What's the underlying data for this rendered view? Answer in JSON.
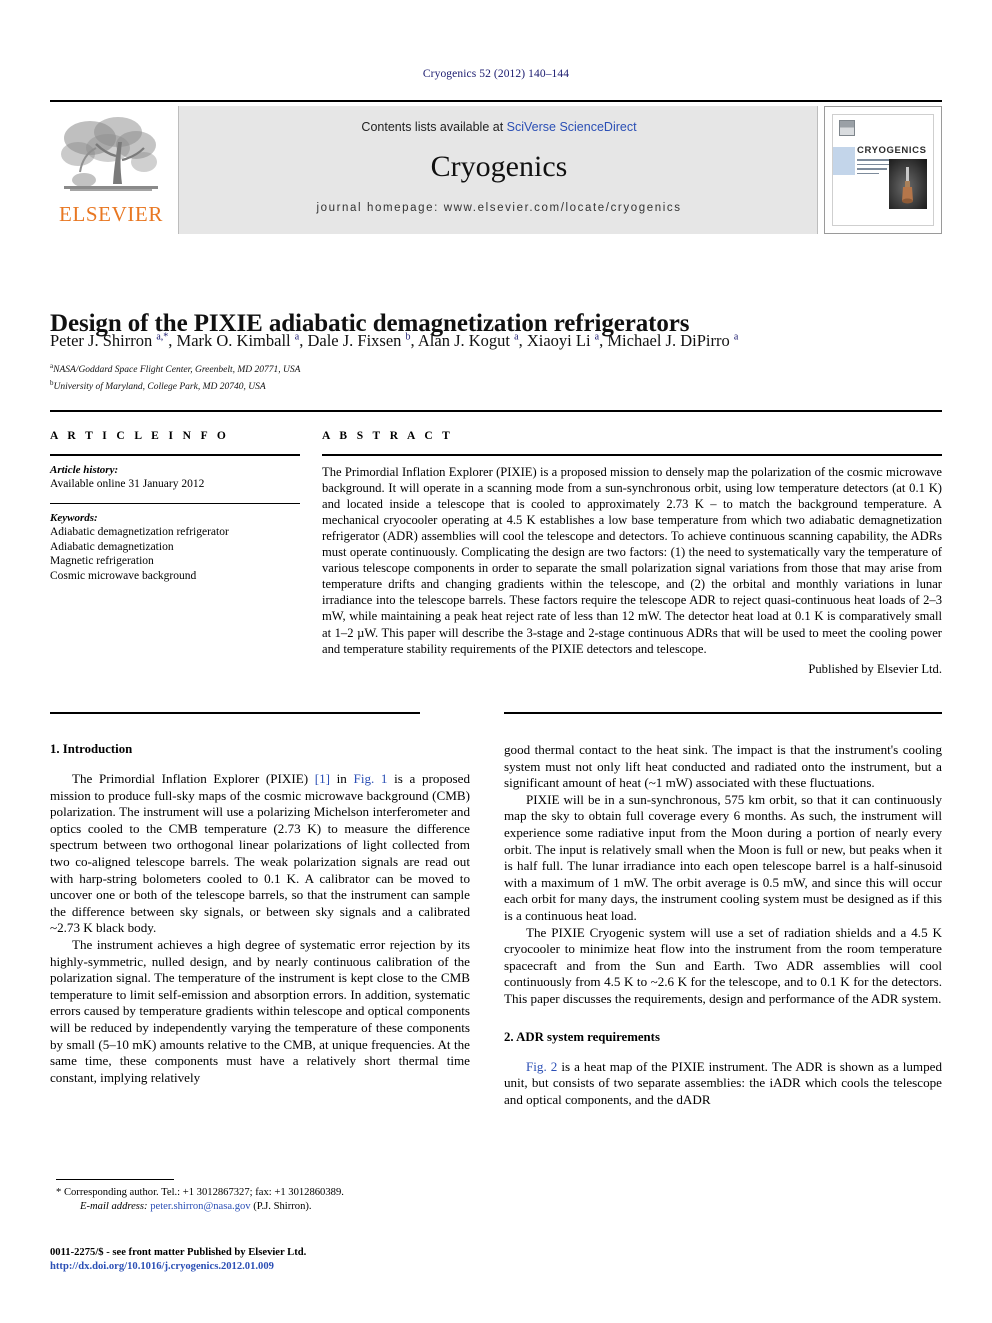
{
  "running_head": "Cryogenics 52 (2012) 140–144",
  "masthead": {
    "contents_prefix": "Contents lists available at ",
    "sciencedirect": "SciVerse ScienceDirect",
    "journal_title": "Cryogenics",
    "homepage": "journal homepage: www.elsevier.com/locate/cryogenics",
    "publisher_logo_text": "ELSEVIER",
    "cover_title": "CRYOGENICS"
  },
  "article": {
    "title": "Design of the PIXIE adiabatic demagnetization refrigerators",
    "authors_html": "Peter J. Shirron <sup>a,*</sup>, Mark O. Kimball <sup>a</sup>, Dale J. Fixsen <sup>b</sup>, Alan J. Kogut <sup>a</sup>, Xiaoyi Li <sup>a</sup>, Michael J. DiPirro <sup>a</sup>",
    "affiliation_a": "NASA/Goddard Space Flight Center, Greenbelt, MD 20771, USA",
    "affiliation_b": "University of Maryland, College Park, MD 20740, USA"
  },
  "article_info": {
    "heading": "A R T I C L E   I N F O",
    "history_label": "Article history:",
    "history_value": "Available online 31 January 2012",
    "keywords_label": "Keywords:",
    "keywords": [
      "Adiabatic demagnetization refrigerator",
      "Adiabatic demagnetization",
      "Magnetic refrigeration",
      "Cosmic microwave background"
    ]
  },
  "abstract": {
    "heading": "A B S T R A C T",
    "text": "The Primordial Inflation Explorer (PIXIE) is a proposed mission to densely map the polarization of the cosmic microwave background. It will operate in a scanning mode from a sun-synchronous orbit, using low temperature detectors (at 0.1 K) and located inside a telescope that is cooled to approximately 2.73 K – to match the background temperature. A mechanical cryocooler operating at 4.5 K establishes a low base temperature from which two adiabatic demagnetization refrigerator (ADR) assemblies will cool the telescope and detectors. To achieve continuous scanning capability, the ADRs must operate continuously. Complicating the design are two factors: (1) the need to systematically vary the temperature of various telescope components in order to separate the small polarization signal variations from those that may arise from temperature drifts and changing gradients within the telescope, and (2) the orbital and monthly variations in lunar irradiance into the telescope barrels. These factors require the telescope ADR to reject quasi-continuous heat loads of 2–3 mW, while maintaining a peak heat reject rate of less than 12 mW. The detector heat load at 0.1 K is comparatively small at 1–2 µW. This paper will describe the 3-stage and 2-stage continuous ADRs that will be used to meet the cooling power and temperature stability requirements of the PIXIE detectors and telescope.",
    "published_by": "Published by Elsevier Ltd."
  },
  "body": {
    "section1_heading": "1. Introduction",
    "section2_heading": "2. ADR system requirements",
    "left_p1_a": "The Primordial Inflation Explorer (PIXIE) ",
    "left_p1_ref": "[1]",
    "left_p1_b": " in ",
    "left_p1_fig": "Fig. 1",
    "left_p1_c": " is a proposed mission to produce full-sky maps of the cosmic microwave background (CMB) polarization. The instrument will use a polarizing Michelson interferometer and optics cooled to the CMB temperature (2.73 K) to measure the difference spectrum between two orthogonal linear polarizations of light collected from two co-aligned telescope barrels. The weak polarization signals are read out with harp-string bolometers cooled to 0.1 K. A calibrator can be moved to uncover one or both of the telescope barrels, so that the instrument can sample the difference between sky signals, or between sky signals and a calibrated ~2.73 K black body.",
    "left_p2": "The instrument achieves a high degree of systematic error rejection by its highly-symmetric, nulled design, and by nearly continuous calibration of the polarization signal. The temperature of the instrument is kept close to the CMB temperature to limit self-emission and absorption errors. In addition, systematic errors caused by temperature gradients within telescope and optical components will be reduced by independently varying the temperature of these components by small (5–10 mK) amounts relative to the CMB, at unique frequencies. At the same time, these components must have a relatively short thermal time constant, implying relatively",
    "right_p1": "good thermal contact to the heat sink. The impact is that the instrument's cooling system must not only lift heat conducted and radiated onto the instrument, but a significant amount of heat (~1 mW) associated with these fluctuations.",
    "right_p2": "PIXIE will be in a sun-synchronous, 575 km orbit, so that it can continuously map the sky to obtain full coverage every 6 months. As such, the instrument will experience some radiative input from the Moon during a portion of nearly every orbit. The input is relatively small when the Moon is full or new, but peaks when it is half full. The lunar irradiance into each open telescope barrel is a half-sinusoid with a maximum of 1 mW. The orbit average is 0.5 mW, and since this will occur each orbit for many days, the instrument cooling system must be designed as if this is a continuous heat load.",
    "right_p3": "The PIXIE Cryogenic system will use a set of radiation shields and a 4.5 K cryocooler to minimize heat flow into the instrument from the room temperature spacecraft and from the Sun and Earth. Two ADR assemblies will cool continuously from 4.5 K to ~2.6 K for the telescope, and to 0.1 K for the detectors. This paper discusses the requirements, design and performance of the ADR system.",
    "right_p4_fig": "Fig. 2",
    "right_p4_rest": " is a heat map of the PIXIE instrument. The ADR is shown as a lumped unit, but consists of two separate assemblies: the iADR which cools the telescope and optical components, and the dADR"
  },
  "footnotes": {
    "corresponding": "* Corresponding author. Tel.: +1 3012867327; fax: +1 3012860389.",
    "email_label": "E-mail address:",
    "email": "peter.shirron@nasa.gov",
    "email_suffix": "(P.J. Shirron).",
    "issn_line": "0011-2275/$ - see front matter Published by Elsevier Ltd.",
    "doi": "http://dx.doi.org/10.1016/j.cryogenics.2012.01.009"
  },
  "colors": {
    "link": "#2b4fb5",
    "elsevier_orange": "#E87722",
    "running_head": "#1a1a6e"
  }
}
